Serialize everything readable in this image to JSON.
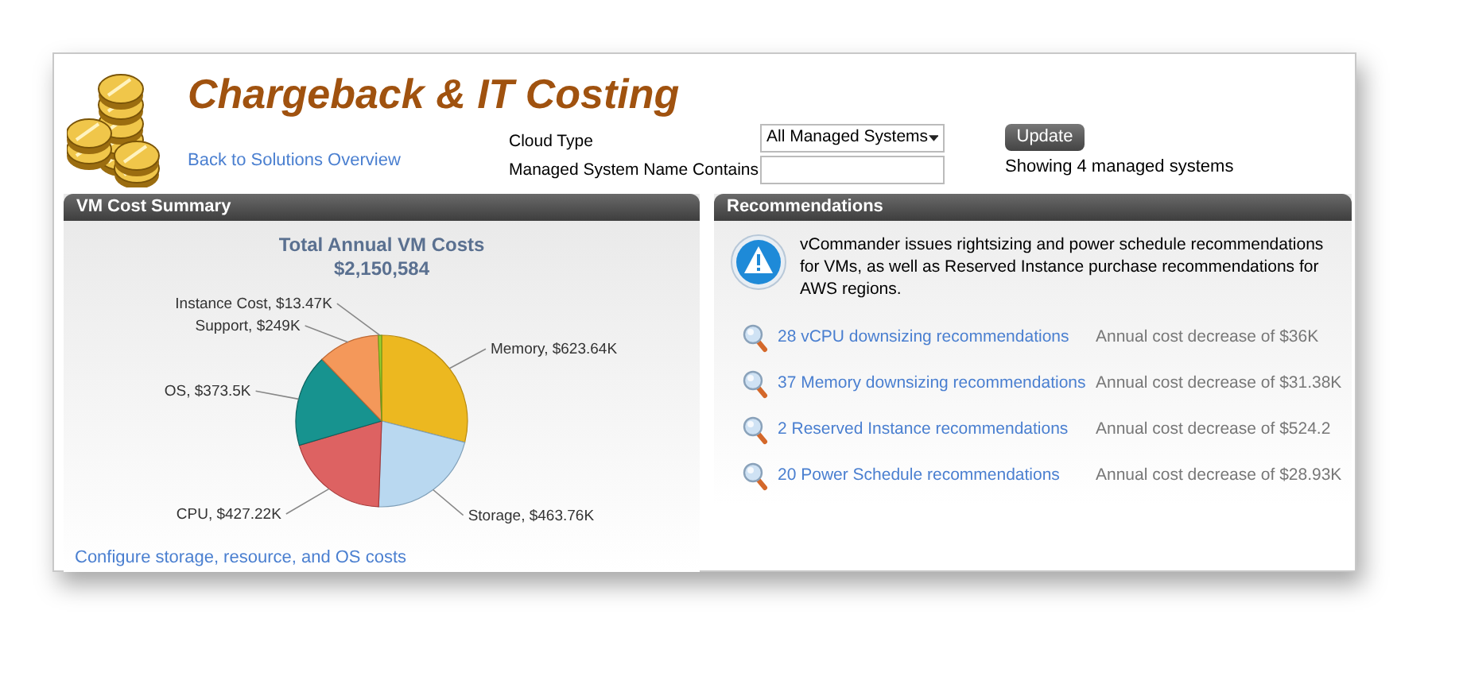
{
  "header": {
    "title": "Chargeback & IT Costing",
    "back_link": "Back to Solutions Overview"
  },
  "filters": {
    "cloud_type_label": "Cloud Type",
    "cloud_type_value": "All Managed Systems",
    "name_label": "Managed System Name Contains",
    "update_button": "Update",
    "status": "Showing 4 managed systems"
  },
  "cost_summary": {
    "title": "VM Cost Summary",
    "chart_title": "Total Annual VM Costs",
    "total": "$2,150,584",
    "configure_link": "Configure storage, resource, and OS costs",
    "chart_data": {
      "type": "pie",
      "categories": [
        "Memory, $623.64K",
        "Storage, $463.76K",
        "CPU, $427.22K",
        "OS, $373.5K",
        "Support, $249K",
        "Instance Cost, $13.47K"
      ],
      "series": [
        {
          "values": [
            623.64,
            463.76,
            427.22,
            373.5,
            249,
            13.47
          ]
        }
      ]
    }
  },
  "recommendations": {
    "title": "Recommendations",
    "notice": "vCommander issues rightsizing and power schedule recommendations for VMs, as well as Reserved Instance purchase recommendations for AWS regions.",
    "items": [
      {
        "link": "28 vCPU downsizing recommendations",
        "saving": "Annual cost decrease of $36K"
      },
      {
        "link": "37 Memory downsizing recommendations",
        "saving": "Annual cost decrease of $31.38K"
      },
      {
        "link": "2 Reserved Instance recommendations",
        "saving": "Annual cost decrease of $524.2"
      },
      {
        "link": "20 Power Schedule recommendations",
        "saving": "Annual cost decrease of $28.93K"
      }
    ]
  }
}
